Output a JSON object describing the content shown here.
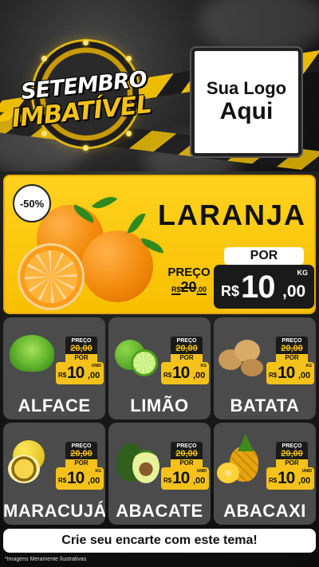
{
  "badge": {
    "line1": "SETEMBRO",
    "line2": "IMBATÍVEL"
  },
  "logo": {
    "line1": "Sua Logo",
    "line2": "Aqui"
  },
  "hero": {
    "discount": "-50%",
    "title": "LARANJA",
    "por": "POR",
    "preco_label": "PREÇO",
    "old_currency": "R$",
    "old_int": "20",
    "old_cents": ",00",
    "currency": "R$",
    "int": "10",
    "cents": ",00",
    "unit": "KG"
  },
  "tag_labels": {
    "preco": "PREÇO",
    "por": "POR",
    "currency": "R$"
  },
  "products": [
    {
      "name": "ALFACE",
      "old": "20,00",
      "int": "10",
      "cents": ",00",
      "unit": "UNID"
    },
    {
      "name": "LIMÃO",
      "old": "20,00",
      "int": "10",
      "cents": ",00",
      "unit": "KG"
    },
    {
      "name": "BATATA",
      "old": "20,00",
      "int": "10",
      "cents": ",00",
      "unit": "KG"
    },
    {
      "name": "MARACUJÁ",
      "old": "20,00",
      "int": "10",
      "cents": ",00",
      "unit": "KG"
    },
    {
      "name": "ABACATE",
      "old": "20,00",
      "int": "10",
      "cents": ",00",
      "unit": "UNID"
    },
    {
      "name": "ABACAXI",
      "old": "20,00",
      "int": "10",
      "cents": ",00",
      "unit": "UNID"
    }
  ],
  "cta": "Crie seu encarte com este tema!",
  "footnote": "*Imagens Meramente Ilustrativas",
  "colors": {
    "yellow": "#F4C21A",
    "dark": "#1A1A1A",
    "card": "#4B4B4B"
  }
}
